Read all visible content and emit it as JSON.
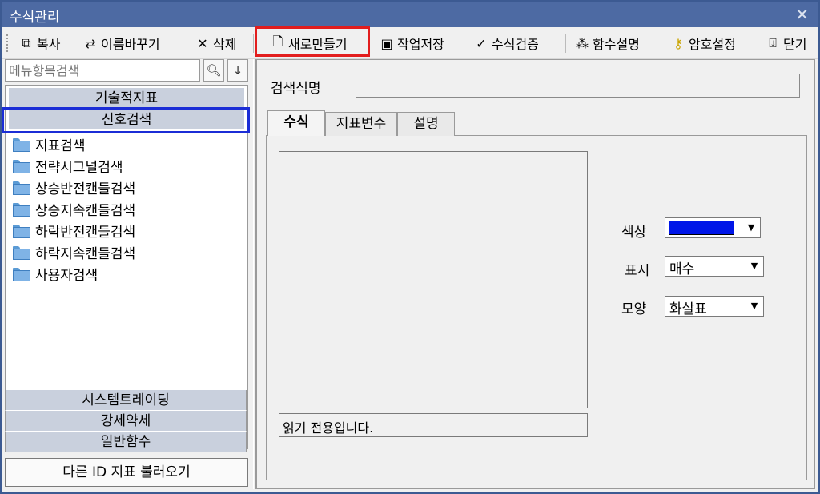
{
  "window": {
    "title": "수식관리"
  },
  "toolbar": {
    "copy": "복사",
    "rename": "이름바꾸기",
    "delete": "삭제",
    "new": "새로만들기",
    "save": "작업저장",
    "verify": "수식검증",
    "func_help": "함수설명",
    "password": "암호설정",
    "close": "닫기"
  },
  "search": {
    "placeholder": "메뉴항목검색"
  },
  "tree": {
    "category_top": "기술적지표",
    "category_selected": "신호검색",
    "items": [
      "지표검색",
      "전략시그널검색",
      "상승반전캔들검색",
      "상승지속캔들검색",
      "하락반전캔들검색",
      "하락지속캔들검색",
      "사용자검색"
    ],
    "bottom_categories": [
      "시스템트레이딩",
      "강세약세",
      "일반함수"
    ]
  },
  "load_button": "다른 ID 지표 불러오기",
  "form": {
    "name_label": "검색식명",
    "name_value": "",
    "tabs": [
      "수식",
      "지표변수",
      "설명"
    ],
    "readonly_text": "읽기 전용입니다.",
    "color_label": "색상",
    "color_value": "#0016e8",
    "display_label": "표시",
    "display_value": "매수",
    "shape_label": "모양",
    "shape_value": "화살표"
  },
  "colors": {
    "titlebar": "#4d6aa3",
    "highlight_red": "#e21d1d",
    "highlight_blue": "#1b2dd6",
    "category_bg": "#c9d0dd"
  }
}
